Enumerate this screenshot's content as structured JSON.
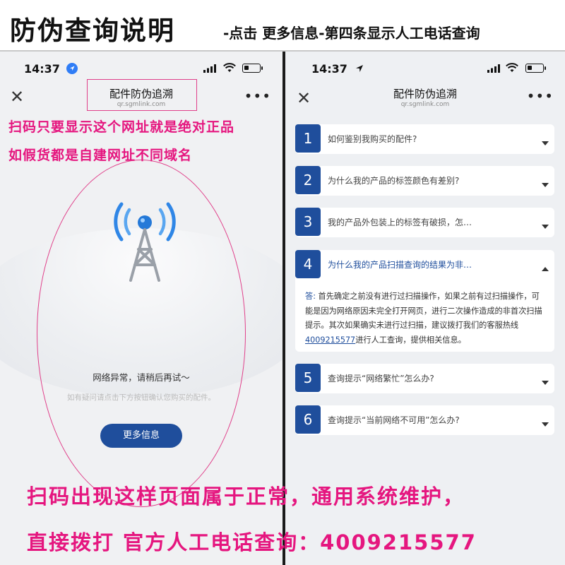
{
  "banner": {
    "title": "防伪查询说明",
    "subtitle": "-点击 更多信息-第四条显示人工电话查询"
  },
  "left_phone": {
    "status": {
      "time": "14:37"
    },
    "nav": {
      "title": "配件防伪追溯",
      "url": "qr.sgmlink.com"
    },
    "annotations": [
      "扫码只要显示这个网址就是绝对正品",
      "如假货都是自建网址不同域名"
    ],
    "error_text": "网络异常，请稍后再试～",
    "error_sub": "如有疑问请点击下方按钮确认您购买的配件。",
    "button_label": "更多信息"
  },
  "right_phone": {
    "status": {
      "time": "14:37"
    },
    "nav": {
      "title": "配件防伪追溯",
      "url": "qr.sgmlink.com"
    },
    "faq": [
      {
        "num": "1",
        "question": "如何鉴别我购买的配件?"
      },
      {
        "num": "2",
        "question": "为什么我的产品的标签颜色有差别?"
      },
      {
        "num": "3",
        "question": "我的产品外包装上的标签有破损，怎…"
      },
      {
        "num": "4",
        "question": "为什么我的产品扫描查询的结果为非…"
      },
      {
        "num": "5",
        "question": "查询提示“网络繁忙”怎么办?"
      },
      {
        "num": "6",
        "question": "查询提示“当前网络不可用”怎么办?"
      }
    ],
    "answer": {
      "label": "答:",
      "text_before": "  首先确定之前没有进行过扫描操作，如果之前有过扫描操作，可能是因为网络原因未完全打开网页，进行二次操作造成的非首次扫描提示。其次如果确实未进行过扫描，建议拨打我们的客服热线 ",
      "phone": "4009215577",
      "text_after": "进行人工查询，提供相关信息。"
    }
  },
  "bottom": {
    "line1": "扫码出现这样页面属于正常，通用系统维护，",
    "line2": "直接拨打 官方人工电话查询：4009215577"
  },
  "colors": {
    "accent": "#1f4e9c",
    "annotation": "#e5167f"
  }
}
